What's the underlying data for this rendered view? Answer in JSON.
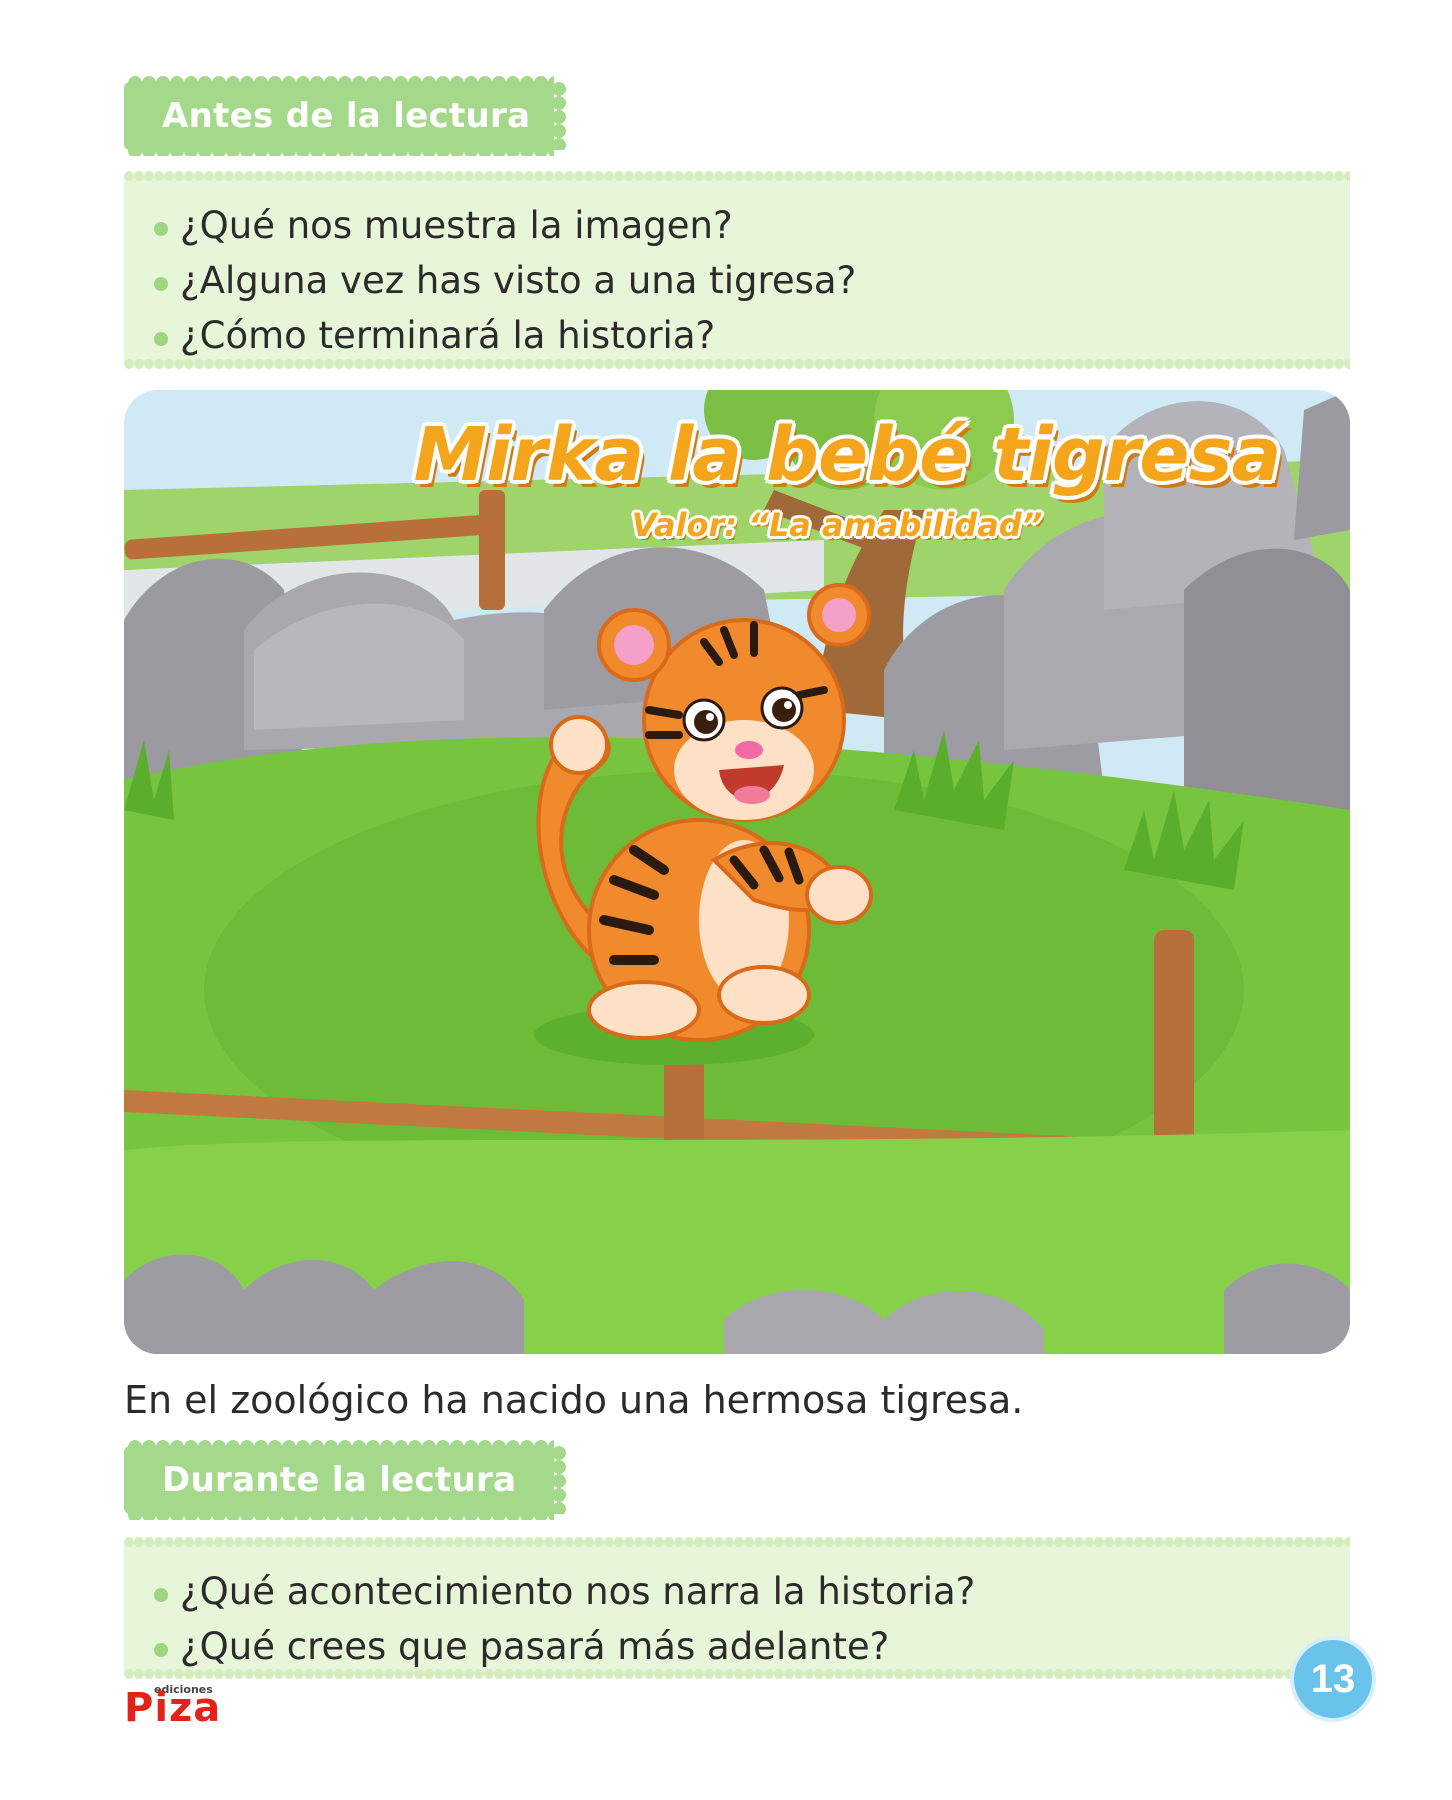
{
  "before_reading": {
    "heading": "Antes de la lectura",
    "questions": [
      "¿Qué nos muestra la imagen?",
      "¿Alguna vez has visto a una tigresa?",
      "¿Cómo terminará la historia?"
    ]
  },
  "story": {
    "title": "Mirka la bebé tigresa",
    "subtitle": "Valor: “La amabilidad”",
    "first_line": "En el zoológico ha nacido una hermosa tigresa."
  },
  "during_reading": {
    "heading": "Durante la lectura",
    "questions": [
      "¿Qué acontecimiento nos narra la historia?",
      "¿Qué crees que pasará más adelante?"
    ]
  },
  "footer": {
    "publisher_small": "ediciones",
    "publisher_name": "Piza",
    "page_number": "13"
  },
  "colors": {
    "tab_green": "#a4d98c",
    "box_green": "#e7f6d8",
    "title_orange": "#f5a51c",
    "page_badge": "#69c3ea",
    "logo_red": "#e2231a"
  }
}
